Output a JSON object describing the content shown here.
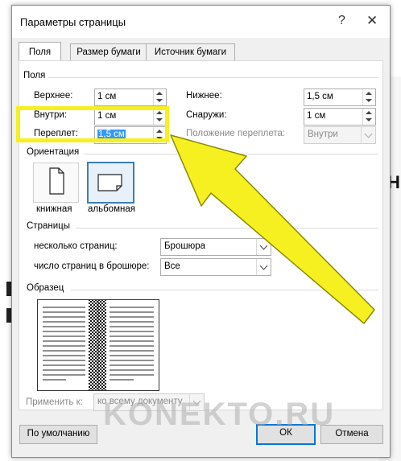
{
  "dialog": {
    "title": "Параметры страницы",
    "help_glyph": "?",
    "close_glyph": "✕",
    "tabs": [
      {
        "label": "Поля",
        "active": true
      },
      {
        "label": "Размер бумаги",
        "active": false
      },
      {
        "label": "Источник бумаги",
        "active": false
      }
    ]
  },
  "margins": {
    "section_title": "Поля",
    "top": {
      "label": "Верхнее:",
      "value": "1 см"
    },
    "bottom": {
      "label": "Нижнее:",
      "value": "1,5 см"
    },
    "inside": {
      "label": "Внутри:",
      "value": "1 см"
    },
    "outside": {
      "label": "Снаружи:",
      "value": "1 см"
    },
    "gutter": {
      "label": "Переплет:",
      "value": "1,5 см"
    },
    "gutter_position": {
      "label": "Положение переплета:",
      "value": "Внутри"
    }
  },
  "orientation": {
    "section_title": "Ориентация",
    "portrait_label": "книжная",
    "landscape_label": "альбомная",
    "selected": "landscape"
  },
  "pages": {
    "section_title": "Страницы",
    "multiple_label": "несколько страниц:",
    "multiple_value": "Брошюра",
    "count_label": "число страниц в брошюре:",
    "count_value": "Все"
  },
  "preview": {
    "section_title": "Образец"
  },
  "apply": {
    "label": "Применить к:",
    "value": "ко всему документу"
  },
  "buttons": {
    "default": "По умолчанию",
    "ok": "ОК",
    "cancel": "Отмена"
  },
  "watermark": "KONEKTO.RU",
  "colors": {
    "highlight": "#f6f020",
    "accent": "#0078d7",
    "selected_border": "#3c7fb1"
  }
}
